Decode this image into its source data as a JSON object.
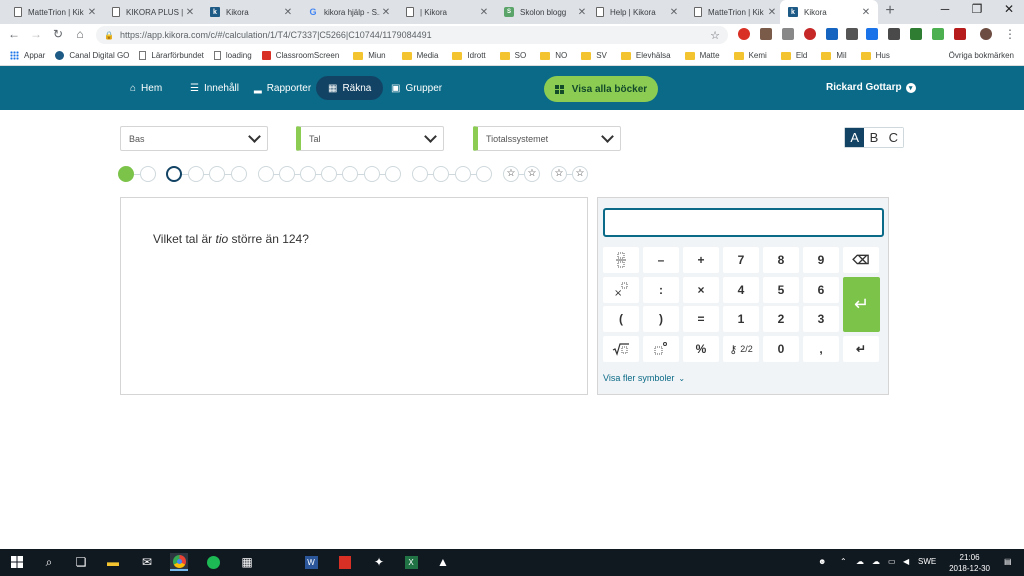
{
  "browser": {
    "tabs": [
      {
        "label": "MatteTrion | Kik",
        "icon": "doc"
      },
      {
        "label": "KIKORA PLUS | ...",
        "icon": "doc"
      },
      {
        "label": "Kikora",
        "icon": "k"
      },
      {
        "label": "kikora hjälp - S...",
        "icon": "g"
      },
      {
        "label": "| Kikora",
        "icon": "doc"
      },
      {
        "label": "Skolon blogg",
        "icon": "sk"
      },
      {
        "label": "Help | Kikora",
        "icon": "doc"
      },
      {
        "label": "MatteTrion | Kik",
        "icon": "doc"
      },
      {
        "label": "Kikora",
        "icon": "k"
      }
    ],
    "url": "https://app.kikora.com/c/#/calculation/1/T4/C7337|C5266|C10744/1179084491"
  },
  "bookmarks": {
    "items": [
      {
        "label": "Appar",
        "icon": "apps"
      },
      {
        "label": "Canal Digital GO",
        "icon": "blue"
      },
      {
        "label": "Lärarförbundet",
        "icon": "page"
      },
      {
        "label": "loading",
        "icon": "page"
      },
      {
        "label": "ClassroomScreen",
        "icon": "red"
      },
      {
        "label": "Miun",
        "icon": "folder"
      },
      {
        "label": "Media",
        "icon": "folder"
      },
      {
        "label": "Idrott",
        "icon": "folder"
      },
      {
        "label": "SO",
        "icon": "folder"
      },
      {
        "label": "NO",
        "icon": "folder"
      },
      {
        "label": "SV",
        "icon": "folder"
      },
      {
        "label": "Elevhälsa",
        "icon": "folder"
      },
      {
        "label": "Matte",
        "icon": "folder"
      },
      {
        "label": "Kemi",
        "icon": "folder"
      },
      {
        "label": "Eld",
        "icon": "folder"
      },
      {
        "label": "Mil",
        "icon": "folder"
      },
      {
        "label": "Hus",
        "icon": "folder"
      }
    ],
    "other": "Övriga bokmärken"
  },
  "nav": {
    "home": "Hem",
    "content": "Innehåll",
    "reports": "Rapporter",
    "calculate": "Räkna",
    "groups": "Grupper",
    "show_all_books": "Visa alla böcker",
    "user": "Rickard Gottarp"
  },
  "selectors": {
    "level": "Bas",
    "topic": "Tal",
    "subtopic": "Tiotalssystemet",
    "difficulty": [
      "A",
      "B",
      "C"
    ],
    "difficulty_selected": "A"
  },
  "progress": {
    "completed": 1,
    "current": 2,
    "stars": [
      "☆",
      "☆",
      "☆",
      "☆"
    ]
  },
  "question": {
    "before": "Vilket tal är ",
    "emphasis": "tio",
    "after": " större än 124?"
  },
  "keypad": {
    "answer_value": "",
    "keys": {
      "minus": "–",
      "plus": "+",
      "seven": "7",
      "eight": "8",
      "nine": "9",
      "colon": ":",
      "times": "×",
      "four": "4",
      "five": "5",
      "six": "6",
      "lparen": "(",
      "rparen": ")",
      "equals": "=",
      "one": "1",
      "two": "2",
      "three": "3",
      "percent": "%",
      "page": "2/2",
      "zero": "0",
      "comma": ",",
      "backspace": "⌫",
      "enter": "↵"
    },
    "more_symbols": "Visa fler symboler"
  },
  "taskbar": {
    "language": "SWE",
    "time": "21:06",
    "date": "2018-12-30"
  },
  "colors": {
    "nav_bg": "#0a6a87",
    "accent_green": "#8ccc53",
    "dark_navy": "#124364"
  }
}
